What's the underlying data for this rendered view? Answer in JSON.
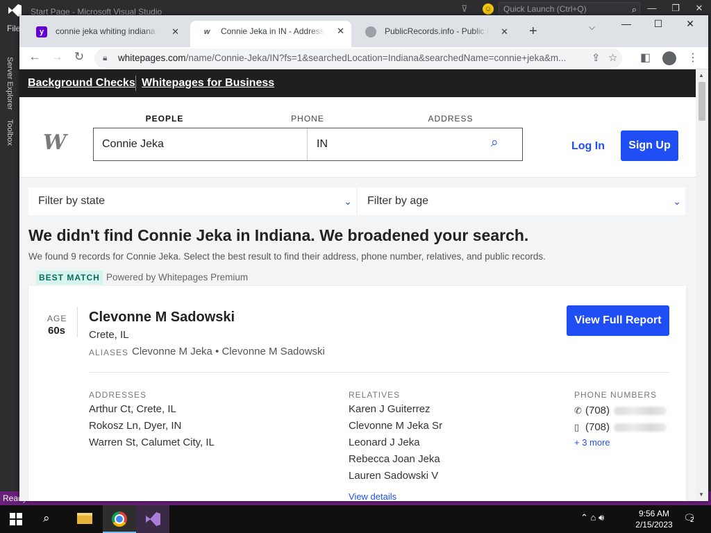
{
  "vs": {
    "title": "Start Page - Microsoft Visual Studio",
    "quick_launch_placeholder": "Quick Launch (Ctrl+Q)",
    "menu_file": "File",
    "side_tabs": [
      "Server Explorer",
      "Toolbox"
    ],
    "status": "Ready",
    "accent": "#68217a"
  },
  "chrome": {
    "tabs": [
      {
        "title": "connie jeka whiting indiana - Yah",
        "favicon": "yahoo-icon",
        "active": false
      },
      {
        "title": "Connie Jeka in IN - Address & Ph",
        "favicon": "whitepages-icon",
        "active": true
      },
      {
        "title": "PublicRecords.info - Public Reco",
        "favicon": "publicrecords-icon",
        "active": false
      }
    ],
    "url_host": "whitepages.com",
    "url_path": "/name/Connie-Jeka/IN?fs=1&searchedLocation=Indiana&searchedName=connie+jeka&m..."
  },
  "page": {
    "top_links": [
      "Background Checks",
      "Whitepages for Business"
    ],
    "search_tabs": [
      "PEOPLE",
      "PHONE",
      "ADDRESS"
    ],
    "search_name_value": "Connie Jeka",
    "search_location_value": "IN",
    "login_label": "Log In",
    "signup_label": "Sign Up",
    "filter_state": "Filter by state",
    "filter_age": "Filter by age",
    "headline": "We didn't find Connie Jeka in Indiana. We broadened your search.",
    "subline": "We found 9 records for Connie Jeka. Select the best result to find their address, phone number, relatives, and public records.",
    "best_match": "BEST MATCH",
    "powered_by": "Powered by Whitepages Premium",
    "brand_color": "#1f4ef5"
  },
  "result": {
    "age_label": "AGE",
    "age_value": "60s",
    "name": "Clevonne M Sadowski",
    "location": "Crete, IL",
    "aliases_label": "ALIASES",
    "aliases": "Clevonne M Jeka • Clevonne M Sadowski",
    "view_report": "View Full Report",
    "addresses_label": "ADDRESSES",
    "addresses": [
      "Arthur Ct, Crete, IL",
      "Rokosz Ln, Dyer, IN",
      "Warren St, Calumet City, IL"
    ],
    "relatives_label": "RELATIVES",
    "relatives": [
      "Karen J Guiterrez",
      "Clevonne M Jeka Sr",
      "Leonard J Jeka",
      "Rebecca Joan Jeka",
      "Lauren Sadowski V"
    ],
    "view_details": "View details",
    "phones_label": "PHONE NUMBERS",
    "phones": [
      "(708)",
      "(708)"
    ],
    "more_phones": "+ 3 more"
  },
  "taskbar": {
    "time": "9:56 AM",
    "date": "2/15/2023",
    "notification_count": "2"
  }
}
